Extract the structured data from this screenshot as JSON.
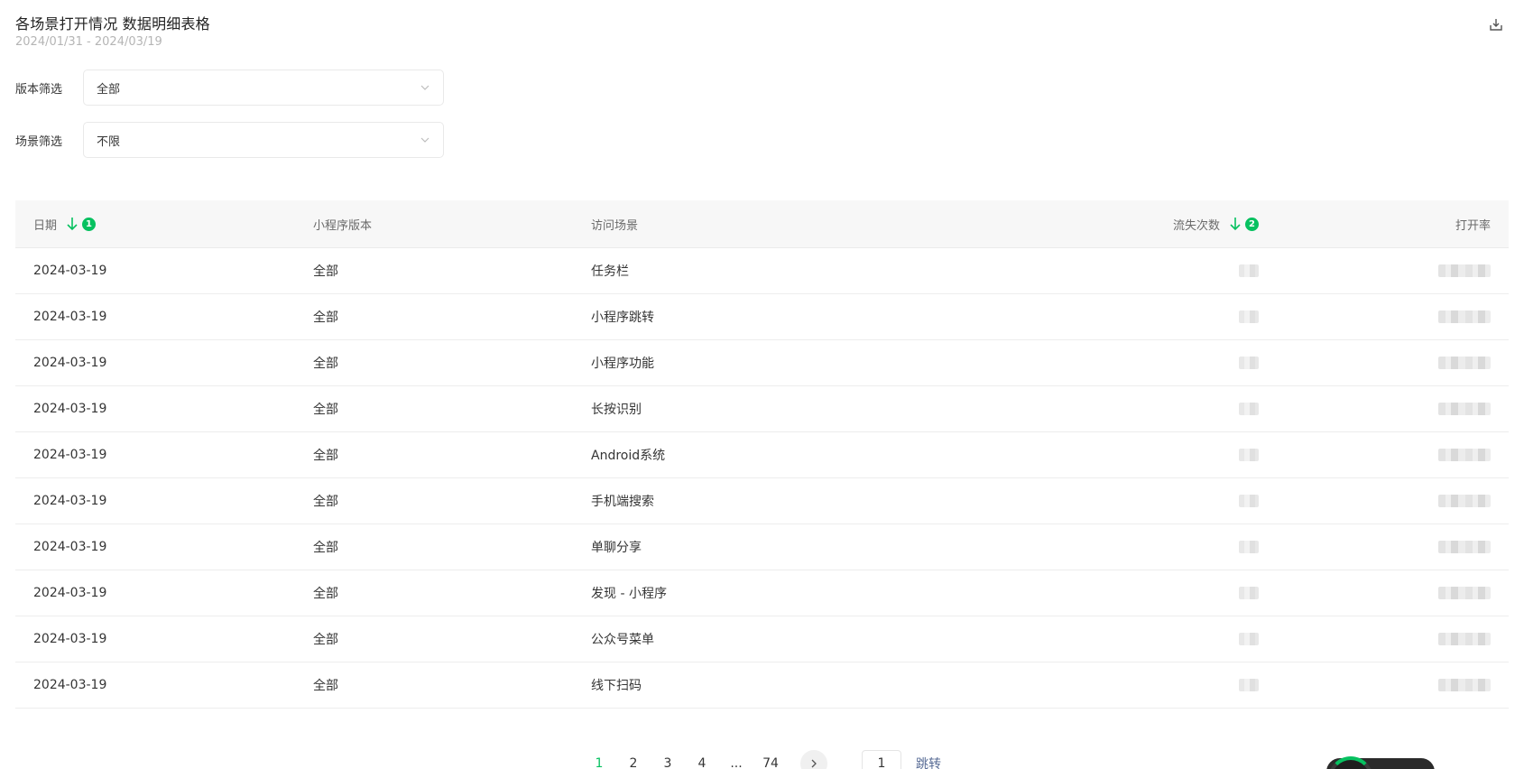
{
  "header": {
    "title": "各场景打开情况 数据明细表格",
    "date_range": "2024/01/31 - 2024/03/19",
    "export_icon": "download-icon"
  },
  "filters": {
    "version": {
      "label": "版本筛选",
      "value": "全部"
    },
    "scene": {
      "label": "场景筛选",
      "value": "不限"
    }
  },
  "table": {
    "columns": {
      "date": "日期",
      "date_sort_order": "1",
      "version": "小程序版本",
      "scene": "访问场景",
      "loss": "流失次数",
      "loss_sort_order": "2",
      "open_rate": "打开率"
    },
    "rows": [
      {
        "date": "2024-03-19",
        "version": "全部",
        "scene": "任务栏"
      },
      {
        "date": "2024-03-19",
        "version": "全部",
        "scene": "小程序跳转"
      },
      {
        "date": "2024-03-19",
        "version": "全部",
        "scene": "小程序功能"
      },
      {
        "date": "2024-03-19",
        "version": "全部",
        "scene": "长按识别"
      },
      {
        "date": "2024-03-19",
        "version": "全部",
        "scene": "Android系统"
      },
      {
        "date": "2024-03-19",
        "version": "全部",
        "scene": "手机端搜索"
      },
      {
        "date": "2024-03-19",
        "version": "全部",
        "scene": "单聊分享"
      },
      {
        "date": "2024-03-19",
        "version": "全部",
        "scene": "发现 - 小程序"
      },
      {
        "date": "2024-03-19",
        "version": "全部",
        "scene": "公众号菜单"
      },
      {
        "date": "2024-03-19",
        "version": "全部",
        "scene": "线下扫码"
      }
    ]
  },
  "pagination": {
    "pages": [
      "1",
      "2",
      "3",
      "4",
      "...",
      "74"
    ],
    "current": "1",
    "jump_value": "1",
    "jump_label": "跳转"
  },
  "colors": {
    "accent": "#07c160",
    "link": "#576b95"
  }
}
